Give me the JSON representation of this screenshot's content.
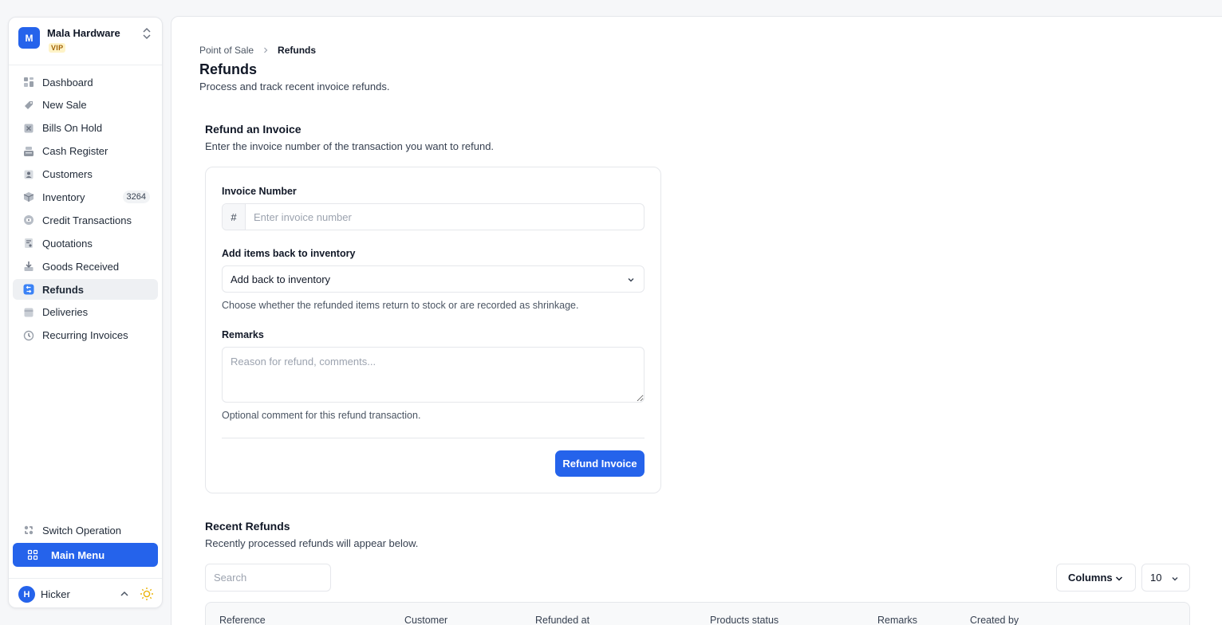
{
  "org": {
    "initial": "M",
    "name": "Mala Hardware",
    "badge": "VIP"
  },
  "nav": {
    "items": [
      {
        "label": "Dashboard",
        "icon": "dashboard-icon"
      },
      {
        "label": "New Sale",
        "icon": "tag-icon"
      },
      {
        "label": "Bills On Hold",
        "icon": "hold-icon"
      },
      {
        "label": "Cash Register",
        "icon": "register-icon"
      },
      {
        "label": "Customers",
        "icon": "customers-icon"
      },
      {
        "label": "Inventory",
        "icon": "box-icon",
        "count": "3264"
      },
      {
        "label": "Credit Transactions",
        "icon": "credit-icon"
      },
      {
        "label": "Quotations",
        "icon": "quotation-icon"
      },
      {
        "label": "Goods Received",
        "icon": "download-icon"
      },
      {
        "label": "Refunds",
        "icon": "refund-icon",
        "active": true
      },
      {
        "label": "Deliveries",
        "icon": "delivery-icon"
      },
      {
        "label": "Recurring Invoices",
        "icon": "recurring-icon"
      }
    ],
    "switch_operation": "Switch Operation",
    "main_menu": "Main Menu"
  },
  "user": {
    "initial": "H",
    "name": "Hicker"
  },
  "breadcrumb": {
    "parent": "Point of Sale",
    "current": "Refunds"
  },
  "page": {
    "title": "Refunds",
    "subtitle": "Process and track recent invoice refunds."
  },
  "refund_form": {
    "title": "Refund an Invoice",
    "subtitle": "Enter the invoice number of the transaction you want to refund.",
    "invoice_label": "Invoice Number",
    "invoice_prefix": "#",
    "invoice_placeholder": "Enter invoice number",
    "inventory_label": "Add items back to inventory",
    "inventory_value": "Add back to inventory",
    "inventory_help": "Choose whether the refunded items return to stock or are recorded as shrinkage.",
    "remarks_label": "Remarks",
    "remarks_placeholder": "Reason for refund, comments...",
    "remarks_help": "Optional comment for this refund transaction.",
    "submit_label": "Refund Invoice"
  },
  "recent": {
    "title": "Recent Refunds",
    "subtitle": "Recently processed refunds will appear below.",
    "search_placeholder": "Search",
    "columns_label": "Columns",
    "page_size": "10",
    "headers": [
      "Reference",
      "Customer",
      "Refunded at",
      "Products status",
      "Remarks",
      "Created by"
    ]
  },
  "colors": {
    "accent": "#2563eb",
    "badge_bg": "#fef3c7",
    "badge_text": "#a16207"
  }
}
